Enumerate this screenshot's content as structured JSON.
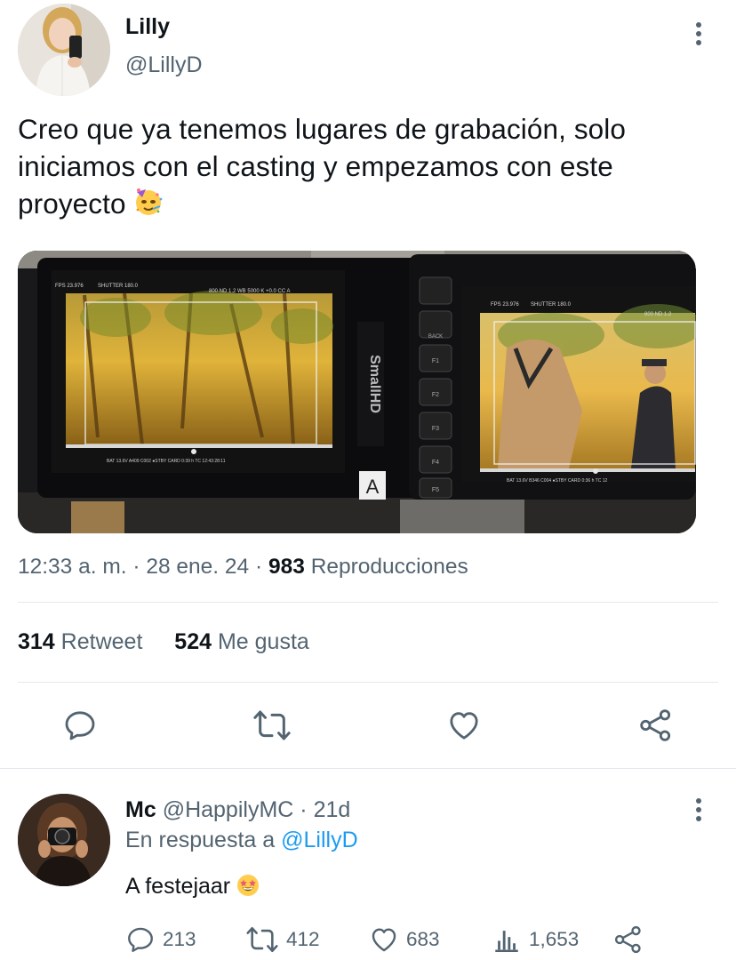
{
  "tweet": {
    "author_name": "Lilly",
    "author_handle": "@LillyD",
    "text_line1": "Creo que ya tenemos lugares de grabación, solo",
    "text_line2": "iniciamos con el casting y empezamos con este",
    "text_line3": "proyecto",
    "emoji": "partying-face-emoji",
    "media": {
      "monitor_left": {
        "fps": "FPS 23.976",
        "shutter": "SHUTTER 180.0",
        "top_right": "800  ND 1.2   WB 5000 K  +0.0 CC  A",
        "bottom": "BAT 13.6V    A409 C002  ●STBY   CARD   0:39 h     TC 12:43:28:11",
        "brand": "SmallHD",
        "label": "A"
      },
      "monitor_right": {
        "fps": "FPS 23.976",
        "shutter": "SHUTTER 180.0",
        "top_right": "800  ND 1.2",
        "bottom": "BAT 13.6V    B346 C004  ●STBY   CARD   0:36 h    TC 12",
        "side_buttons": [
          "BACK",
          "F1",
          "F2",
          "F3",
          "F4",
          "F5"
        ]
      }
    },
    "time": "12:33 a. m.",
    "sep": "·",
    "date": "28 ene. 24",
    "views": "983",
    "views_label": "Reproducciones",
    "retweets": "314",
    "retweets_label": "Retweet",
    "likes": "524",
    "likes_label": "Me gusta"
  },
  "actions": {
    "reply_icon": "reply-icon",
    "retweet_icon": "retweet-icon",
    "like_icon": "heart-icon",
    "share_icon": "share-icon"
  },
  "reply": {
    "name": "Mc",
    "handle": "@HappilyMC",
    "sep": "·",
    "age": "21d",
    "in_reply_prefix": "En respuesta a",
    "in_reply_mention": "@LillyD",
    "text": "A festejaar",
    "emoji": "star-struck-emoji",
    "reply_count": "213",
    "retweet_count": "412",
    "like_count": "683",
    "view_count": "1,653"
  },
  "colors": {
    "text": "#0f1419",
    "secondary": "#536471",
    "link": "#1d9bf0",
    "divider": "#e3e8ec"
  }
}
